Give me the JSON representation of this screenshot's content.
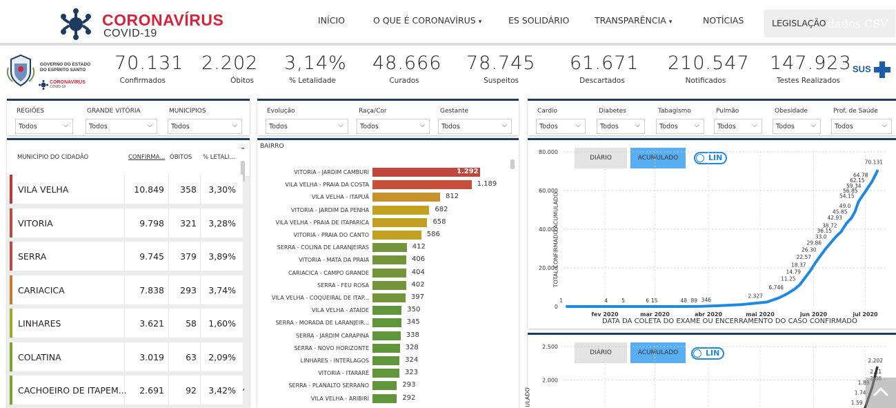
{
  "brand": {
    "title": "CORONAVÍRUS",
    "subtitle": "COVID-19"
  },
  "nav": {
    "items": [
      {
        "label": "INÍCIO",
        "dropdown": false
      },
      {
        "label": "O QUE É CORONAVÍRUS",
        "dropdown": true
      },
      {
        "label": "ES SOLIDÁRIO",
        "dropdown": false
      },
      {
        "label": "TRANSPARÊNCIA",
        "dropdown": true
      },
      {
        "label": "NOTÍCIAS",
        "dropdown": false
      }
    ],
    "legislacao": "LEGISLAÇÃO",
    "ghost_text": "dados CSV",
    "caret": "▾"
  },
  "gov": {
    "line1": "GOVERNO DO ESTADO",
    "line2": "DO ESPÍRITO SANTO",
    "brand1": "CORONAVÍRUS",
    "brand2": "COVID-19"
  },
  "kpis": [
    {
      "value": "70.131",
      "label": "Confirmados"
    },
    {
      "value": "2.202",
      "label": "Óbitos"
    },
    {
      "value": "3,14%",
      "label": "% Letalidade"
    },
    {
      "value": "48.666",
      "label": "Curados"
    },
    {
      "value": "78.745",
      "label": "Suspeitos"
    },
    {
      "value": "61.671",
      "label": "Descartados"
    },
    {
      "value": "210.547",
      "label": "Notificados"
    },
    {
      "value": "147.923",
      "label": "Testes Realizados"
    }
  ],
  "sus": "SUS",
  "filters": {
    "group1": [
      {
        "label": "REGIÕES",
        "value": "Todos"
      },
      {
        "label": "GRANDE VITÓRIA",
        "value": "Todos"
      },
      {
        "label": "MUNICÍPIOS",
        "value": "Todos"
      }
    ],
    "group2": [
      {
        "label": "Evolução",
        "value": "Todos"
      },
      {
        "label": "Raça/Cor",
        "value": "Todos"
      },
      {
        "label": "Gestante",
        "value": "Todos"
      }
    ],
    "group3": [
      {
        "label": "Cardio",
        "value": "Todos"
      },
      {
        "label": "Diabetes",
        "value": "Todos"
      },
      {
        "label": "Tabagismo",
        "value": "Todos"
      },
      {
        "label": "Pulmão",
        "value": "Todos"
      },
      {
        "label": "Obesidade",
        "value": "Todos"
      },
      {
        "label": "Prof. de Saúde",
        "value": "Todos"
      }
    ],
    "chevron": "⌵"
  },
  "table": {
    "headers": [
      "MUNICÍPIO DO CIDADÃO",
      "CONFIRMA...",
      "ÓBITOS",
      "% LETALI..."
    ],
    "sort_arrow": "⌃",
    "rows": [
      {
        "name": "VILA VELHA",
        "confirmados": "10.849",
        "obitos": "358",
        "letalidade": "3,30%",
        "color": "#b83b3b"
      },
      {
        "name": "VITORIA",
        "confirmados": "9.798",
        "obitos": "321",
        "letalidade": "3,28%",
        "color": "#b84c3b"
      },
      {
        "name": "SERRA",
        "confirmados": "9.745",
        "obitos": "379",
        "letalidade": "3,89%",
        "color": "#b84c3b"
      },
      {
        "name": "CARIACICA",
        "confirmados": "7.838",
        "obitos": "293",
        "letalidade": "3,74%",
        "color": "#c87b2a"
      },
      {
        "name": "LINHARES",
        "confirmados": "3.621",
        "obitos": "58",
        "letalidade": "1,60%",
        "color": "#9aaa22"
      },
      {
        "name": "COLATINA",
        "confirmados": "3.019",
        "obitos": "63",
        "letalidade": "2,09%",
        "color": "#7aa32a"
      },
      {
        "name": "CACHOEIRO DE ITAPEM...",
        "confirmados": "2.691",
        "obitos": "92",
        "letalidade": "3,42%",
        "color": "#7aa32a"
      }
    ],
    "scroll_down": "⌄"
  },
  "bairro": {
    "title": "BAIRRO",
    "max": 1292,
    "items": [
      {
        "label": "VITORIA - JARDIM CAMBURI",
        "value": 1292,
        "text": "1.292",
        "color": "#c0463c"
      },
      {
        "label": "VILA VELHA - PRAIA DA COSTA",
        "value": 1189,
        "text": "1.189",
        "color": "#c8503a"
      },
      {
        "label": "VILA VELHA - ITAPUÃ",
        "value": 812,
        "text": "812",
        "color": "#c8922a"
      },
      {
        "label": "VITORIA - JARDIM DA PENHA",
        "value": 682,
        "text": "682",
        "color": "#c4a021"
      },
      {
        "label": "VILA VELHA - PRAIA DE ITAPARICA",
        "value": 658,
        "text": "658",
        "color": "#c4a021"
      },
      {
        "label": "VITORIA - PRAIA DO CANTO",
        "value": 586,
        "text": "586",
        "color": "#c4a021"
      },
      {
        "label": "SERRA - COLINA DE LARANJEIRAS",
        "value": 412,
        "text": "412",
        "color": "#72953a"
      },
      {
        "label": "VITORIA - MATA DA PRAIA",
        "value": 406,
        "text": "406",
        "color": "#72953a"
      },
      {
        "label": "CARIACICA - CAMPO GRANDE",
        "value": 404,
        "text": "404",
        "color": "#72953a"
      },
      {
        "label": "SERRA - FEU ROSA",
        "value": 402,
        "text": "402",
        "color": "#72953a"
      },
      {
        "label": "VILA VELHA - COQUEIRAL DE ITAP...",
        "value": 397,
        "text": "397",
        "color": "#72953a"
      },
      {
        "label": "VILA VELHA - ATAÍDE",
        "value": 350,
        "text": "350",
        "color": "#5f963a"
      },
      {
        "label": "SERRA - MORADA DE LARANJEIR...",
        "value": 345,
        "text": "345",
        "color": "#5f963a"
      },
      {
        "label": "SERRA - JARDIM CARAPINA",
        "value": 338,
        "text": "338",
        "color": "#5f963a"
      },
      {
        "label": "SERRA - NOVO HORIZONTE",
        "value": 328,
        "text": "328",
        "color": "#5f963a"
      },
      {
        "label": "LINHARES - INTERLAGOS",
        "value": 324,
        "text": "324",
        "color": "#5f963a"
      },
      {
        "label": "VITORIA - ITARARÉ",
        "value": 323,
        "text": "323",
        "color": "#5f963a"
      },
      {
        "label": "SERRA - PLANALTO SERRANO",
        "value": 293,
        "text": "293",
        "color": "#5f963a"
      },
      {
        "label": "VILA VELHA - ARIBIRÍ",
        "value": 292,
        "text": "292",
        "color": "#5f963a"
      }
    ]
  },
  "chart_data": [
    {
      "type": "line",
      "ylabel": "TOTAL CONFIRMADO ACUMULADO",
      "xlabel": "DATA DA COLETA DO EXAME OU ENCERRAMENTO DO CASO CONFIRMADO",
      "yticks": [
        "80.000",
        "60.000",
        "40.000",
        "20.000",
        "0"
      ],
      "ylim": [
        0,
        80000
      ],
      "xticks": [
        "fev 2020",
        "mar 2020",
        "abr 2020",
        "mai 2020",
        "jun 2020",
        "jul 2020"
      ],
      "buttons": [
        "DIÁRIO",
        "ACUMULADO"
      ],
      "toggle": "LIN",
      "color": "#1e88e5",
      "grid": true,
      "series": [
        {
          "x": [
            "2020-01-10",
            "2020-01-25",
            "2020-02-05",
            "2020-02-15",
            "2020-02-29",
            "2020-03-05",
            "2020-03-15",
            "2020-03-22",
            "2020-03-28",
            "2020-04-05",
            "2020-04-20",
            "2020-05-05",
            "2020-05-12",
            "2020-05-17",
            "2020-05-21",
            "2020-05-24",
            "2020-05-27",
            "2020-05-30",
            "2020-06-02",
            "2020-06-05",
            "2020-06-08",
            "2020-06-11",
            "2020-06-14",
            "2020-06-17",
            "2020-06-20",
            "2020-06-23",
            "2020-06-25",
            "2020-06-27",
            "2020-06-29",
            "2020-07-01",
            "2020-07-03",
            "2020-07-05",
            "2020-07-08"
          ],
          "values": [
            1,
            1,
            4,
            5,
            6,
            15,
            15,
            48,
            89,
            346,
            1000,
            2327,
            4500,
            6746,
            9000,
            11250,
            14791,
            18371,
            22573,
            26300,
            29862,
            33000,
            36158,
            38727,
            42935,
            45859,
            49000,
            54159,
            56850,
            59347,
            62150,
            64787,
            70131
          ]
        }
      ],
      "point_labels": [
        {
          "i": 0,
          "text": "1"
        },
        {
          "i": 2,
          "text": "4"
        },
        {
          "i": 3,
          "text": "5"
        },
        {
          "i": 4,
          "text": "6"
        },
        {
          "i": 5,
          "text": "15"
        },
        {
          "i": 7,
          "text": "48"
        },
        {
          "i": 8,
          "text": "89"
        },
        {
          "i": 9,
          "text": "346"
        },
        {
          "i": 11,
          "text": "2.327"
        },
        {
          "i": 13,
          "text": "6.746"
        },
        {
          "i": 15,
          "text": "11.25"
        },
        {
          "i": 16,
          "text": "14.79"
        },
        {
          "i": 17,
          "text": "18.37"
        },
        {
          "i": 18,
          "text": "22.57"
        },
        {
          "i": 19,
          "text": "26.30"
        },
        {
          "i": 20,
          "text": "29.86"
        },
        {
          "i": 21,
          "text": "33.0"
        },
        {
          "i": 22,
          "text": "36.15"
        },
        {
          "i": 23,
          "text": "38.72"
        },
        {
          "i": 24,
          "text": "42.93"
        },
        {
          "i": 25,
          "text": "45.85"
        },
        {
          "i": 26,
          "text": "49.0"
        },
        {
          "i": 27,
          "text": "54.15"
        },
        {
          "i": 28,
          "text": "56.85"
        },
        {
          "i": 29,
          "text": "59.34"
        },
        {
          "i": 30,
          "text": "62.15"
        },
        {
          "i": 31,
          "text": "64.78"
        },
        {
          "i": 32,
          "text": "70.131"
        }
      ]
    },
    {
      "type": "line",
      "ylabel": "ULADO",
      "yticks": [
        "2.500",
        "2.000"
      ],
      "ylim": [
        0,
        2500
      ],
      "buttons": [
        "DIÁRIO",
        "ACUMULADO"
      ],
      "toggle": "LIN",
      "color": "#333333",
      "series": [
        {
          "x": [
            "2020-06-28",
            "2020-07-01",
            "2020-07-03",
            "2020-07-05",
            "2020-07-08"
          ],
          "values": [
            1400,
            1590,
            1740,
            1890,
            2202
          ]
        }
      ],
      "point_labels": [
        {
          "i": 1,
          "text": "1.59"
        },
        {
          "i": 2,
          "text": "1.74"
        },
        {
          "i": 3,
          "text": "1.89"
        },
        {
          "i": 4,
          "text": "2.202"
        }
      ],
      "extra_labels": [
        "2.11",
        "2.00"
      ]
    }
  ]
}
